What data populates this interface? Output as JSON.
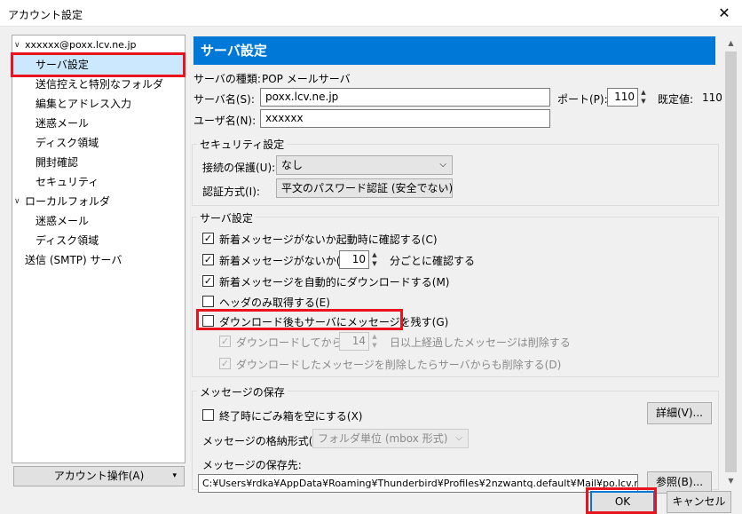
{
  "window": {
    "title": "アカウント設定",
    "close_icon": "✕"
  },
  "sidebar": {
    "account": "xxxxxx@poxx.lcv.ne.jp",
    "server_settings": "サーバ設定",
    "copies_folders": "送信控えと特別なフォルダ",
    "composition": "編集とアドレス入力",
    "junk": "迷惑メール",
    "disk_space": "ディスク領域",
    "return_receipts": "開封確認",
    "security": "セキュリティ",
    "local_folders": "ローカルフォルダ",
    "local_junk": "迷惑メール",
    "local_disk": "ディスク領域",
    "smtp": "送信 (SMTP) サーバ"
  },
  "account_actions": {
    "label": "アカウント操作(A)",
    "caret": "▾"
  },
  "header": {
    "title": "サーバ設定"
  },
  "server": {
    "type_label": "サーバの種類:",
    "type_value": "POP メールサーバ",
    "name_label": "サーバ名(S):",
    "name_value": "poxx.lcv.ne.jp",
    "port_label": "ポート(P):",
    "port_value": "110",
    "default_label": "既定値:",
    "default_value": "110",
    "user_label": "ユーザ名(N):",
    "user_value": "xxxxxx"
  },
  "security": {
    "title": "セキュリティ設定",
    "conn_label": "接続の保護(U):",
    "conn_value": "なし",
    "auth_label": "認証方式(I):",
    "auth_value": "平文のパスワード認証 (安全でない)"
  },
  "settings": {
    "title": "サーバ設定",
    "check_startup": {
      "label": "新着メッセージがないか起動時に確認する(C)",
      "checked": true
    },
    "check_every": {
      "label": "新着メッセージがないか(Y)",
      "checked": true
    },
    "check_every_value": "10",
    "check_every_suffix": "分ごとに確認する",
    "auto_download": {
      "label": "新着メッセージを自動的にダウンロードする(M)",
      "checked": true
    },
    "headers_only": {
      "label": "ヘッダのみ取得する(E)",
      "checked": false
    },
    "leave_on_server": {
      "label": "ダウンロード後もサーバにメッセージを残す(G)",
      "checked": false
    },
    "delete_after": {
      "label": "ダウンロードしてから(O)",
      "checked": true
    },
    "delete_after_value": "14",
    "delete_after_suffix": "日以上経過したメッセージは削除する",
    "delete_on_server": {
      "label": "ダウンロードしたメッセージを削除したらサーバからも削除する(D)",
      "checked": true
    }
  },
  "storage": {
    "title": "メッセージの保存",
    "empty_trash": {
      "label": "終了時にごみ箱を空にする(X)",
      "checked": false
    },
    "advanced_button": "詳細(V)...",
    "format_label": "メッセージの格納形式(T):",
    "format_value": "フォルダ単位 (mbox 形式)",
    "location_label": "メッセージの保存先:",
    "location_value": "C:¥Users¥rdka¥AppData¥Roaming¥Thunderbird¥Profiles¥2nzwantq.default¥Mail¥po.lcv.ne.jp",
    "browse_button": "参照(B)..."
  },
  "footer": {
    "ok": "OK",
    "cancel": "キャンセル"
  },
  "colors": {
    "accent": "#0078d7",
    "highlight_box": "#e8141e",
    "selection": "#cce8ff"
  }
}
